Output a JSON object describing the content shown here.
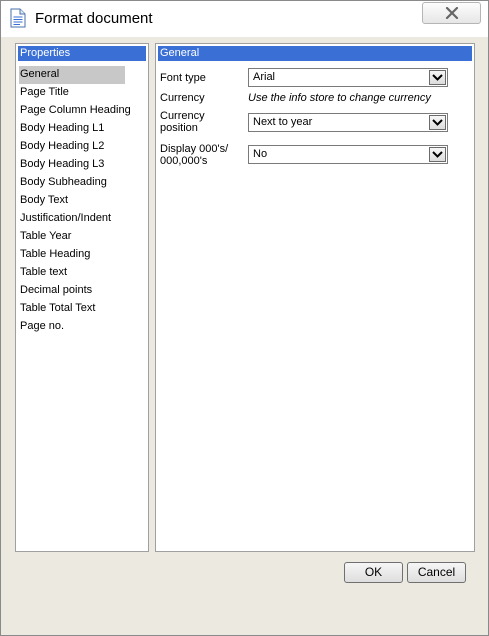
{
  "window": {
    "title": "Format document",
    "close_icon": "close-x-icon",
    "doc_icon": "document-icon"
  },
  "properties": {
    "header": "Properties",
    "items": [
      {
        "label": "General",
        "selected": true
      },
      {
        "label": "Page Title"
      },
      {
        "label": "Page Column Heading"
      },
      {
        "label": "Body Heading L1"
      },
      {
        "label": "Body Heading L2"
      },
      {
        "label": "Body Heading L3"
      },
      {
        "label": "Body Subheading"
      },
      {
        "label": "Body Text"
      },
      {
        "label": "Justification/Indent"
      },
      {
        "label": "Table Year"
      },
      {
        "label": "Table Heading"
      },
      {
        "label": "Table text"
      },
      {
        "label": "Decimal points"
      },
      {
        "label": "Table Total Text"
      },
      {
        "label": "Page no."
      }
    ]
  },
  "general": {
    "header": "General",
    "font_type_label": "Font type",
    "font_type_value": "Arial",
    "currency_label": "Currency",
    "currency_info": "Use the info store to change currency",
    "currency_position_label": "Currency position",
    "currency_position_value": "Next to year",
    "display_label": "Display 000's/ 000,000's",
    "display_value": "No"
  },
  "buttons": {
    "ok": "OK",
    "cancel": "Cancel"
  },
  "colors": {
    "header_blue": "#3a6fd6",
    "selection_gray": "#c8c8c8",
    "dialog_bg": "#eceae0"
  }
}
